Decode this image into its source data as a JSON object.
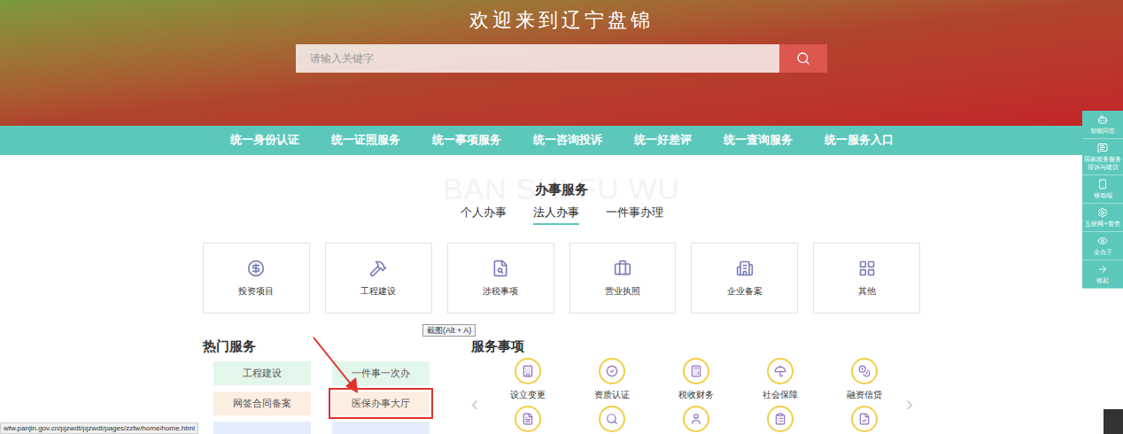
{
  "banner": {
    "title": "欢迎来到辽宁盘锦",
    "search": {
      "placeholder": "请输入关键字"
    }
  },
  "nav": [
    "统一身份认证",
    "统一证照服务",
    "统一事项服务",
    "统一咨询投诉",
    "统一好差评",
    "统一查询服务",
    "统一服务入口"
  ],
  "section": {
    "title": "办事服务",
    "watermark": "BAN SHI FU WU",
    "tabs": [
      {
        "label": "个人办事",
        "selected": false
      },
      {
        "label": "法人办事",
        "selected": true
      },
      {
        "label": "一件事办理",
        "selected": false
      }
    ]
  },
  "categories": [
    "投资项目",
    "工程建设",
    "涉税事项",
    "营业执照",
    "企业备案",
    "其他"
  ],
  "hot": {
    "title": "热门服务",
    "items": [
      {
        "label": "工程建设",
        "color": "#e2f6ea",
        "marked": false
      },
      {
        "label": "一件事一次办",
        "color": "#e2f6ea",
        "marked": false
      },
      {
        "label": "网签合同备案",
        "color": "#fdeee2",
        "marked": false
      },
      {
        "label": "医保办事大厅",
        "color": "#fdeee2",
        "marked": true
      },
      {
        "label": "",
        "color": "#e4edfb",
        "marked": false
      },
      {
        "label": "",
        "color": "#e4edfb",
        "marked": false
      }
    ]
  },
  "matters": {
    "title": "服务事项",
    "prev": "‹",
    "next": "›",
    "items": [
      "设立变更",
      "资质认证",
      "税收财务",
      "社会保障",
      "融资信贷",
      "",
      "",
      "",
      "",
      ""
    ]
  },
  "sidebar": [
    "智能问答",
    "国家政务服务投诉与建议",
    "移动端",
    "互联网+督查",
    "金点子",
    "收起"
  ],
  "tooltip": "截图(Alt + A)",
  "status_bar": "wfw.panjin.gov.cn/pjzwdt/pjzwdt/pages/zzfw/home/home.html"
}
